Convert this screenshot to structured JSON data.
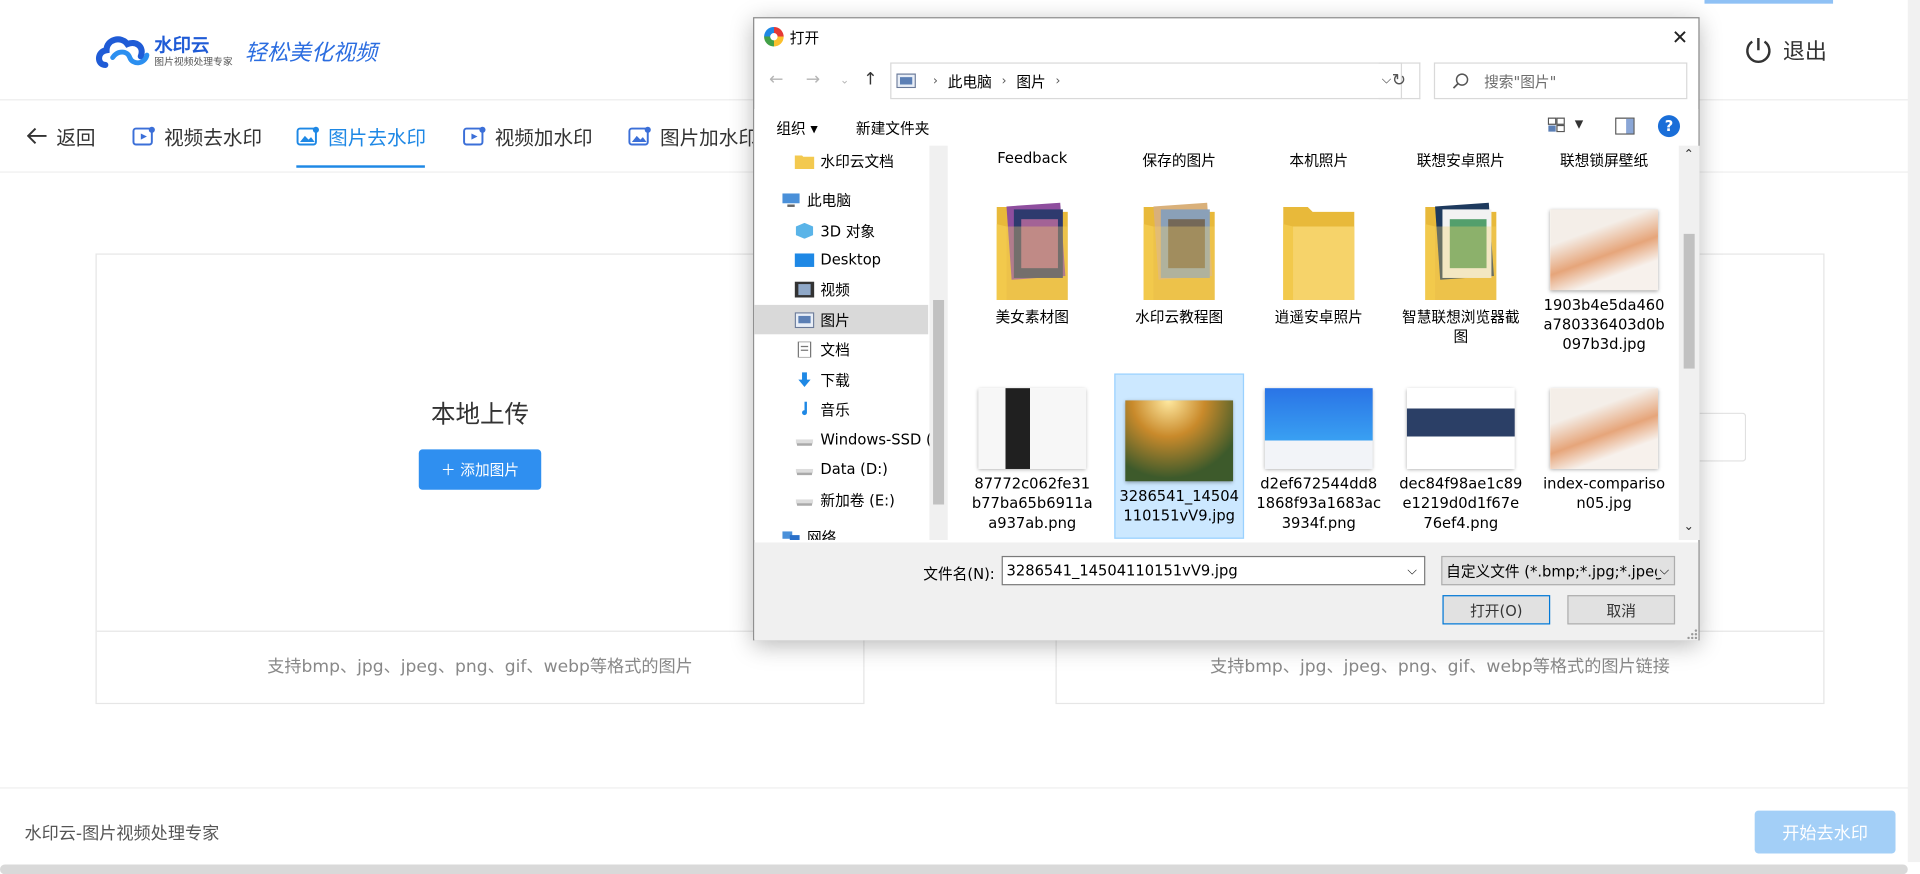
{
  "app": {
    "logo_name": "水印云",
    "logo_sub": "图片视频处理专家",
    "slogan": "轻松美化视频",
    "logout_label": "退出",
    "nav": [
      {
        "label": "返回"
      },
      {
        "label": "视频去水印"
      },
      {
        "label": "图片去水印"
      },
      {
        "label": "视频加水印"
      },
      {
        "label": "图片加水印"
      }
    ],
    "upload_title": "本地上传",
    "add_button": "＋ 添加图片",
    "left_hint": "支持bmp、jpg、jpeg、png、gif、webp等格式的图片",
    "right_hint": "支持bmp、jpg、jpeg、png、gif、webp等格式的图片链接",
    "footer_text": "水印云-图片视频处理专家",
    "start_button": "开始去水印",
    "accent_color": "#1e88e5"
  },
  "dialog": {
    "title": "打开",
    "breadcrumb": [
      "此电脑",
      "图片"
    ],
    "search_placeholder": "搜索\"图片\"",
    "toolbar": {
      "organize": "组织 ▾",
      "new_folder": "新建文件夹"
    },
    "nav_items": [
      {
        "label": "水印云文档",
        "icon": "folder-icon"
      },
      {
        "label": "此电脑",
        "icon": "computer-icon"
      },
      {
        "label": "3D 对象",
        "icon": "cube-icon"
      },
      {
        "label": "Desktop",
        "icon": "desktop-icon"
      },
      {
        "label": "视频",
        "icon": "film-icon"
      },
      {
        "label": "图片",
        "icon": "picture-icon",
        "selected": true
      },
      {
        "label": "文档",
        "icon": "document-icon"
      },
      {
        "label": "下载",
        "icon": "download-icon"
      },
      {
        "label": "音乐",
        "icon": "music-icon"
      },
      {
        "label": "Windows-SSD (",
        "icon": "drive-icon"
      },
      {
        "label": "Data (D:)",
        "icon": "drive-icon"
      },
      {
        "label": "新加卷 (E:)",
        "icon": "drive-icon"
      },
      {
        "label": "网络",
        "icon": "network-icon"
      }
    ],
    "top_labels": [
      "Feedback",
      "保存的图片",
      "本机照片",
      "联想安卓照片",
      "联想锁屏壁纸"
    ],
    "row1": [
      {
        "name": "美女素材图",
        "type": "folder"
      },
      {
        "name": "水印云教程图",
        "type": "folder"
      },
      {
        "name": "逍遥安卓照片",
        "type": "folder"
      },
      {
        "name": "智慧联想浏览器截图",
        "type": "folder"
      },
      {
        "name": "1903b4e5da460a780336403d0b097b3d.jpg",
        "type": "image"
      }
    ],
    "row2": [
      {
        "name": "87772c062fe31b77ba65b6911aa937ab.png",
        "type": "image"
      },
      {
        "name": "3286541_14504110151vV9.jpg",
        "type": "image",
        "selected": true
      },
      {
        "name": "d2ef672544dd81868f93a1683ac3934f.png",
        "type": "image"
      },
      {
        "name": "dec84f98ae1c89e1219d0d1f67e76ef4.png",
        "type": "image"
      },
      {
        "name": "index-comparison05.jpg",
        "type": "image"
      }
    ],
    "filename_label": "文件名(N):",
    "filename_value": "3286541_14504110151vV9.jpg",
    "filter_value": "自定义文件 (*.bmp;*.jpg;*.jpeg",
    "open_button": "打开(O)",
    "cancel_button": "取消"
  }
}
